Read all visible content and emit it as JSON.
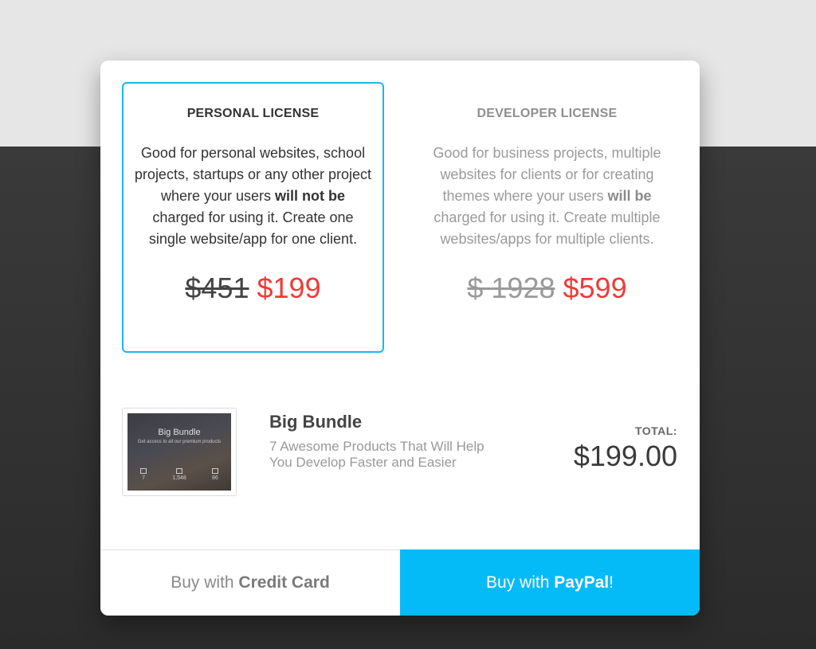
{
  "licenses": {
    "personal": {
      "title": "PERSONAL LICENSE",
      "desc_part1": "Good for personal websites, school projects, startups or any other project where your users ",
      "desc_bold": "will not be",
      "desc_part2": " charged for using it. Create one single website/app for one client.",
      "old_price": "$451",
      "new_price": "$199"
    },
    "developer": {
      "title": "DEVELOPER LICENSE",
      "desc_part1": "Good for business projects, multiple websites for clients or for creating themes where your users ",
      "desc_bold": "will be",
      "desc_part2": " charged for using it. Create multiple websites/apps for multiple clients.",
      "old_price": "$ 1928",
      "new_price": "$599"
    }
  },
  "product": {
    "name": "Big Bundle",
    "description": "7 Awesome Products That Will Help You Develop Faster and Easier",
    "thumbnail": {
      "title": "Big Bundle",
      "subtitle": "Get access to all our premium products",
      "stats": [
        {
          "value": "7",
          "label": "Premium Products"
        },
        {
          "value": "1,548",
          "label": "Components"
        },
        {
          "value": "86",
          "label": "Example Pages"
        }
      ]
    }
  },
  "total": {
    "label": "TOTAL:",
    "value": "$199.00"
  },
  "buttons": {
    "credit_card": {
      "prefix": "Buy with ",
      "bold": "Credit Card",
      "suffix": ""
    },
    "paypal": {
      "prefix": "Buy with ",
      "bold": "PayPal",
      "suffix": "!"
    }
  },
  "colors": {
    "accent": "#1bb8ea",
    "paypal_button": "#04bbf8",
    "price_new": "#ef3b36"
  }
}
